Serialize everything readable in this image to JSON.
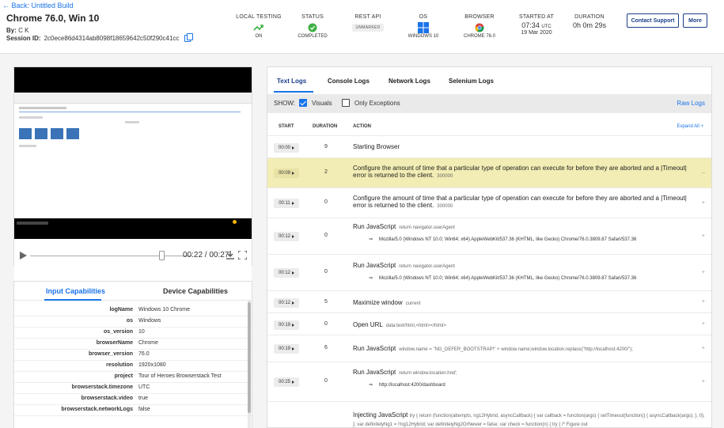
{
  "header": {
    "back": "← Back: Untitled Build",
    "title": "Chrome 76.0, Win 10",
    "by_label": "By:",
    "by_value": "C K",
    "session_label": "Session ID:",
    "session_value": "2c0ece86d4314ab8098f18659642c50f290c41cc"
  },
  "meta": {
    "local_testing": {
      "head": "LOCAL TESTING",
      "value": "ON",
      "icon": "connection-icon"
    },
    "status": {
      "head": "STATUS",
      "value": "COMPLETED",
      "icon": "check-circle-icon"
    },
    "rest_api": {
      "head": "REST API",
      "value": "UNMARKED"
    },
    "os": {
      "head": "OS",
      "value": "WINDOWS 10",
      "icon": "windows-icon"
    },
    "browser": {
      "head": "BROWSER",
      "value": "CHROME 76.0",
      "icon": "chrome-icon"
    },
    "started_at": {
      "head": "STARTED AT",
      "time": "07:34",
      "tz": "UTC",
      "date": "19 Mar 2020"
    },
    "duration": {
      "head": "DURATION",
      "value": "0h 0m 29s"
    }
  },
  "buttons": {
    "contact": "Contact Support",
    "more": "More"
  },
  "player": {
    "time": "00:22 / 00:27",
    "progress": 0.81
  },
  "caps": {
    "tabs": [
      "Input Capabilities",
      "Device Capabilities"
    ],
    "rows": [
      {
        "key": "logName",
        "value": "Windows 10 Chrome"
      },
      {
        "key": "os",
        "value": "Windows"
      },
      {
        "key": "os_version",
        "value": "10"
      },
      {
        "key": "browserName",
        "value": "Chrome"
      },
      {
        "key": "browser_version",
        "value": "76.0"
      },
      {
        "key": "resolution",
        "value": "1920x1080"
      },
      {
        "key": "project",
        "value": "Tour of Heroes Browserstack Test"
      },
      {
        "key": "browserstack.timezone",
        "value": "UTC"
      },
      {
        "key": "browserstack.video",
        "value": "true"
      },
      {
        "key": "browserstack.networkLogs",
        "value": "false"
      }
    ]
  },
  "logs": {
    "tabs": [
      "Text Logs",
      "Console Logs",
      "Network Logs",
      "Selenium Logs"
    ],
    "show_label": "SHOW:",
    "visuals_label": "Visuals",
    "exceptions_label": "Only Exceptions",
    "raw_logs": "Raw Logs",
    "columns": {
      "start": "START",
      "duration": "DURATION",
      "action": "ACTION"
    },
    "expand_all": "Expand All +",
    "rows": [
      {
        "start": "00:00",
        "duration": "9",
        "action": "Starting Browser",
        "arg": "",
        "sub": ""
      },
      {
        "start": "00:09",
        "duration": "2",
        "action": "Configure the amount of time that a particular type of operation can execute for before they are aborted and a |Timeout| error is returned to the client.",
        "arg": "300000",
        "sub": ""
      },
      {
        "start": "00:11",
        "duration": "0",
        "action": "Configure the amount of time that a particular type of operation can execute for before they are aborted and a |Timeout| error is returned to the client.",
        "arg": "300000",
        "sub": ""
      },
      {
        "start": "00:12",
        "duration": "0",
        "action": "Run JavaScript",
        "arg": "return navigator.userAgent",
        "sub": "Mozilla/5.0 (Windows NT 10.0; Win64; x64) AppleWebKit/537.36 (KHTML, like Gecko) Chrome/76.0.3809.87 Safari/537.36"
      },
      {
        "start": "00:12",
        "duration": "0",
        "action": "Run JavaScript",
        "arg": "return navigator.userAgent",
        "sub": "Mozilla/5.0 (Windows NT 10.0; Win64; x64) AppleWebKit/537.36 (KHTML, like Gecko) Chrome/76.0.3809.87 Safari/537.36"
      },
      {
        "start": "00:12",
        "duration": "5",
        "action": "Maximize window",
        "arg": "current",
        "sub": ""
      },
      {
        "start": "00:19",
        "duration": "0",
        "action": "Open URL",
        "arg": "data:text/html,<html></html>",
        "sub": ""
      },
      {
        "start": "00:19",
        "duration": "6",
        "action": "Run JavaScript",
        "arg": "window.name = \"NG_DEFER_BOOTSTRAP!\" + window.name;window.location.replace(\"http://localhost:4200/\");",
        "sub": ""
      },
      {
        "start": "00:25",
        "duration": "0",
        "action": "Run JavaScript",
        "arg": "return window.location.href;",
        "sub": "http://localhost:4200/dashboard"
      },
      {
        "start": "",
        "duration": "",
        "action": "Injecting JavaScript",
        "arg": "try { return (function(attempts, ng12Hybrid, asyncCallback) { var callback = function(args) { setTimeout(function() { asyncCallback(args); }, 0); }; var definitelyNg1 = !!ng12Hybrid; var definitelyNg2OrNewer = false; var check = function(n) { try { /* Figure out",
        "sub": ""
      }
    ]
  },
  "colors": {
    "accent": "#1a73e8",
    "navy": "#1a3e8a",
    "highlight": "#f2edb4",
    "success": "#3cb043"
  }
}
